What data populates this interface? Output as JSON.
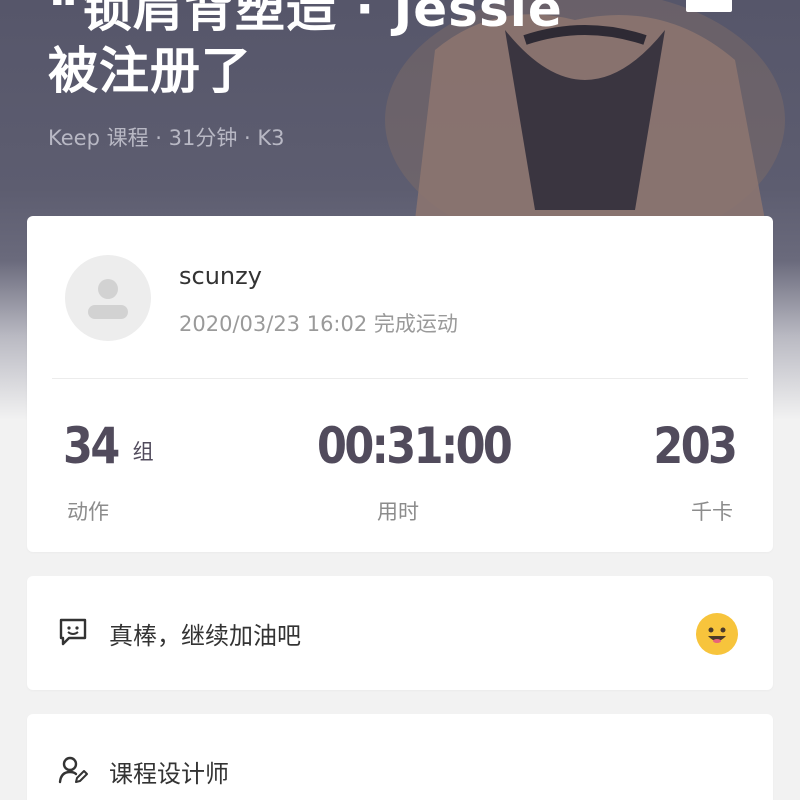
{
  "hero": {
    "title_line1": "“锁肩背塑造 · Jessie",
    "title_line2": "被注册了",
    "meta": "Keep 课程 · 31分钟 · K3"
  },
  "summary": {
    "username": "scunzy",
    "finish_time": "2020/03/23 16:02 完成运动",
    "stats": [
      {
        "value": "34",
        "unit": "组",
        "label": "动作"
      },
      {
        "value": "00:31:00",
        "unit": "",
        "label": "用时"
      },
      {
        "value": "203",
        "unit": "",
        "label": "千卡"
      }
    ]
  },
  "comment": {
    "text": "真棒，继续加油吧",
    "icon": "comment-icon",
    "emoji_icon": "smile-face-icon"
  },
  "designer": {
    "label": "课程设计师",
    "icon": "designer-icon"
  },
  "colors": {
    "hero_bg": "#5d5d70",
    "stat_value": "#514b5c",
    "emoji_yellow": "#f7c43c"
  }
}
